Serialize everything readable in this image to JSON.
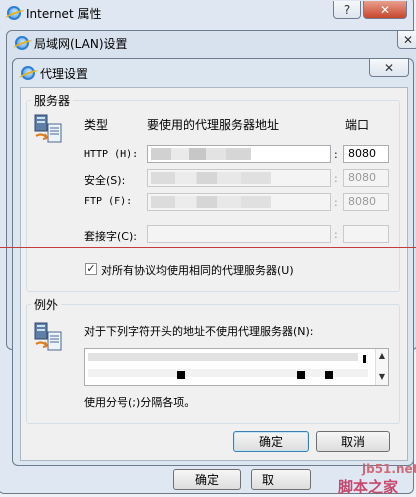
{
  "background_windows": {
    "internet_props": {
      "title": "Internet 属性",
      "ok": "确定",
      "cancel_partial": "取"
    },
    "lan_settings": {
      "title": "局域网(LAN)设置"
    }
  },
  "proxy_dialog": {
    "title": "代理设置",
    "servers": {
      "legend": "服务器",
      "col_type": "类型",
      "col_address": "要使用的代理服务器地址",
      "col_port": "端口",
      "rows": [
        {
          "label": "HTTP (H):",
          "port": "8080",
          "enabled": true
        },
        {
          "label": "安全(S):",
          "port": "8080",
          "enabled": false
        },
        {
          "label": "FTP (F):",
          "port": "8080",
          "enabled": false
        },
        {
          "label": "套接字(C):",
          "port": "",
          "enabled": false
        }
      ],
      "separator": ":",
      "same_proxy_label": "对所有协议均使用相同的代理服务器(U)",
      "same_proxy_checked": true
    },
    "exceptions": {
      "legend": "例外",
      "instruction": "对于下列字符开头的地址不使用代理服务器(N):",
      "hint": "使用分号(;)分隔各项。"
    },
    "ok": "确定",
    "cancel": "取消"
  },
  "watermark": {
    "site": "jb51.net",
    "brand": "脚本之家"
  },
  "icons": {
    "help": "?",
    "close": "✕",
    "check": "✓",
    "scroll_up": "▲",
    "scroll_down": "▼"
  }
}
